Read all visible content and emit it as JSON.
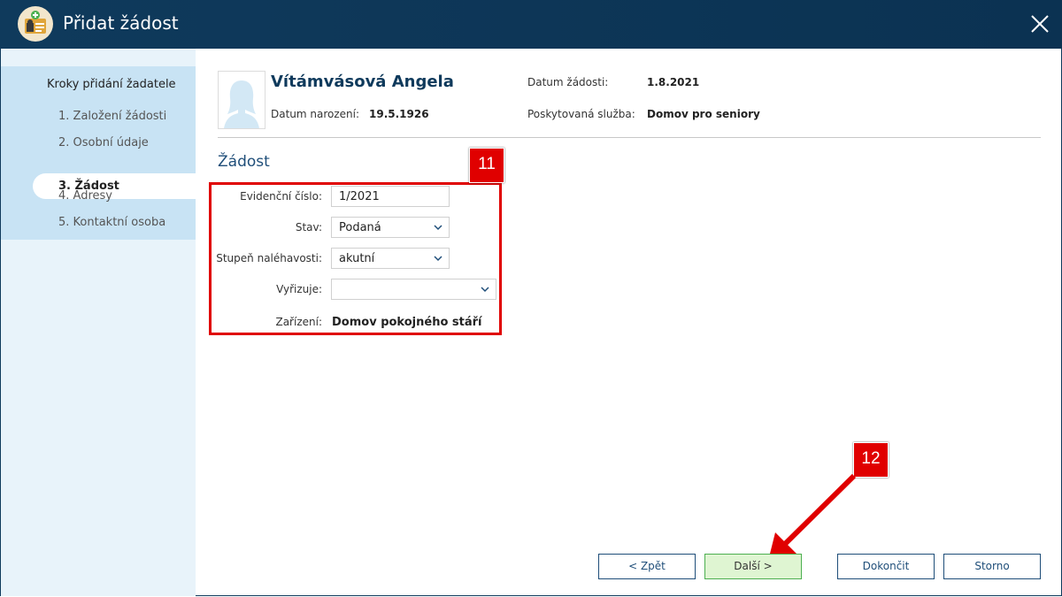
{
  "window": {
    "title": "Přidat žádost"
  },
  "steps": {
    "heading": "Kroky přidání žadatele",
    "items": [
      {
        "label": "1. Založení žádosti",
        "active": false
      },
      {
        "label": "2. Osobní údaje",
        "active": false
      },
      {
        "label": "3. Žádost",
        "active": true
      },
      {
        "label": "4. Adresy",
        "active": false
      },
      {
        "label": "5. Kontaktní osoba",
        "active": false
      }
    ]
  },
  "applicant": {
    "name": "Vítámvásová Angela",
    "birth_label": "Datum narození:",
    "birth_value": "19.5.1926",
    "request_date_label": "Datum žádosti:",
    "request_date_value": "1.8.2021",
    "service_label": "Poskytovaná služba:",
    "service_value": "Domov pro seniory"
  },
  "form": {
    "section_title": "Žádost",
    "evidence_label": "Evidenční číslo:",
    "evidence_value": "1/2021",
    "status_label": "Stav:",
    "status_value": "Podaná",
    "urgency_label": "Stupeň naléhavosti:",
    "urgency_value": "akutní",
    "handler_label": "Vyřizuje:",
    "handler_value": "",
    "facility_label": "Zařízení:",
    "facility_value": "Domov pokojného stáří"
  },
  "callouts": {
    "form_badge": "11",
    "next_badge": "12"
  },
  "buttons": {
    "back": "< Zpět",
    "next": "Další >",
    "finish": "Dokončit",
    "cancel": "Storno"
  },
  "colors": {
    "titlebar": "#0f3a5c",
    "accent": "#1f4e79",
    "callout": "#e00000",
    "next_button": "#dff5d2"
  }
}
